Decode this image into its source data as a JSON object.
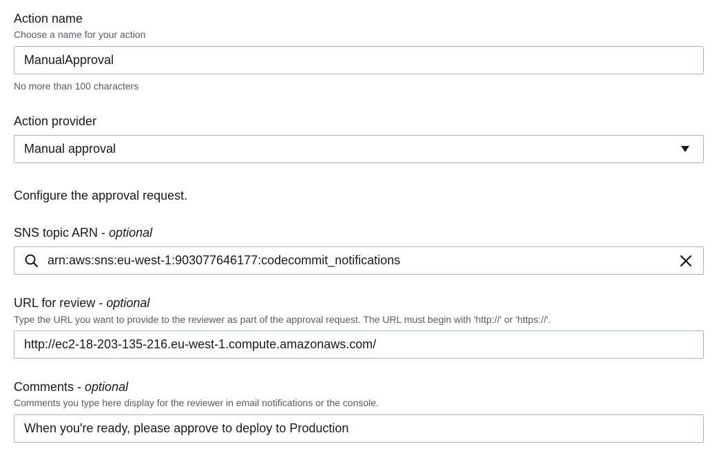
{
  "action_name": {
    "label": "Action name",
    "description": "Choose a name for your action",
    "value": "ManualApproval",
    "constraint": "No more than 100 characters"
  },
  "action_provider": {
    "label": "Action provider",
    "selected": "Manual approval"
  },
  "configure_text": "Configure the approval request.",
  "sns_topic": {
    "label": "SNS topic ARN - ",
    "optional": "optional",
    "value": "arn:aws:sns:eu-west-1:903077646177:codecommit_notifications"
  },
  "url_review": {
    "label": "URL for review - ",
    "optional": "optional",
    "description": "Type the URL you want to provide to the reviewer as part of the approval request. The URL must begin with 'http://' or 'https://'.",
    "value": "http://ec2-18-203-135-216.eu-west-1.compute.amazonaws.com/"
  },
  "comments": {
    "label": "Comments - ",
    "optional": "optional",
    "description": "Comments you type here display for the reviewer in email notifications or the console.",
    "value": "When you're ready, please approve to deploy to Production"
  },
  "icons": {
    "search": "search-icon",
    "clear": "close-icon",
    "caret": "caret-down-icon"
  },
  "colors": {
    "text": "#16191f",
    "secondary_text": "#545b64",
    "border": "#aab7b8"
  }
}
